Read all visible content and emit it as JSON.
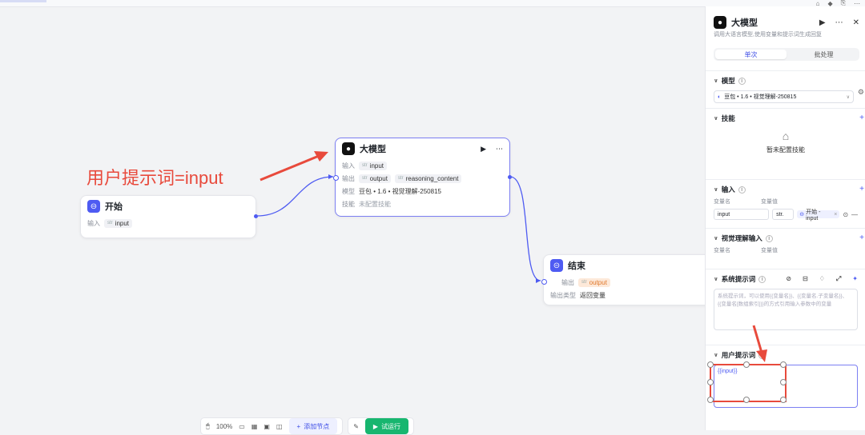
{
  "canvas": {
    "annotation": "用户提示词=input",
    "start_node": {
      "title": "开始",
      "input_label": "输入",
      "input_value": "input"
    },
    "llm_node": {
      "title": "大模型",
      "input_label": "输入",
      "input_value": "input",
      "output_label": "输出",
      "output_values": [
        "output",
        "reasoning_content"
      ],
      "model_label": "模型",
      "model_value": "豆包 • 1.6 • 视觉理解-250815",
      "skill_label": "技能",
      "skill_value": "未配置技能"
    },
    "end_node": {
      "title": "结束",
      "output_label": "输出",
      "output_value": "output",
      "type_label": "输出类型",
      "type_value": "返回变量"
    }
  },
  "panel": {
    "title": "大模型",
    "description": "调用大语言模型,使用变量和提示词生成回复",
    "tabs": [
      "单次",
      "批处理"
    ],
    "model_section": {
      "title": "模型",
      "value": "豆包 • 1.6 • 视觉理解-250815"
    },
    "skills_section": {
      "title": "技能",
      "empty_text": "暂未配置技能"
    },
    "input_section": {
      "title": "输入",
      "col_name": "变量名",
      "col_value": "变量值",
      "name_value": "input",
      "type_value": "str.",
      "ref_value": "开始 - input"
    },
    "vision_section": {
      "title": "视觉理解输入",
      "col_name": "变量名",
      "col_value": "变量值"
    },
    "system_prompt": {
      "title": "系统提示词",
      "placeholder": "系统提示词，可以使用{{变量名}}、{{变量名.子变量名}}、{{变量名[数组索引]}}的方式引用输入参数中的变量"
    },
    "user_prompt": {
      "title": "用户提示词",
      "value": "{{input}}"
    }
  },
  "toolbar": {
    "zoom": "100%",
    "add_node": "添加节点",
    "run": "试运行"
  },
  "colors": {
    "accent": "#4e5bf2",
    "annotation": "#e84a3c",
    "run": "#17b66f"
  }
}
